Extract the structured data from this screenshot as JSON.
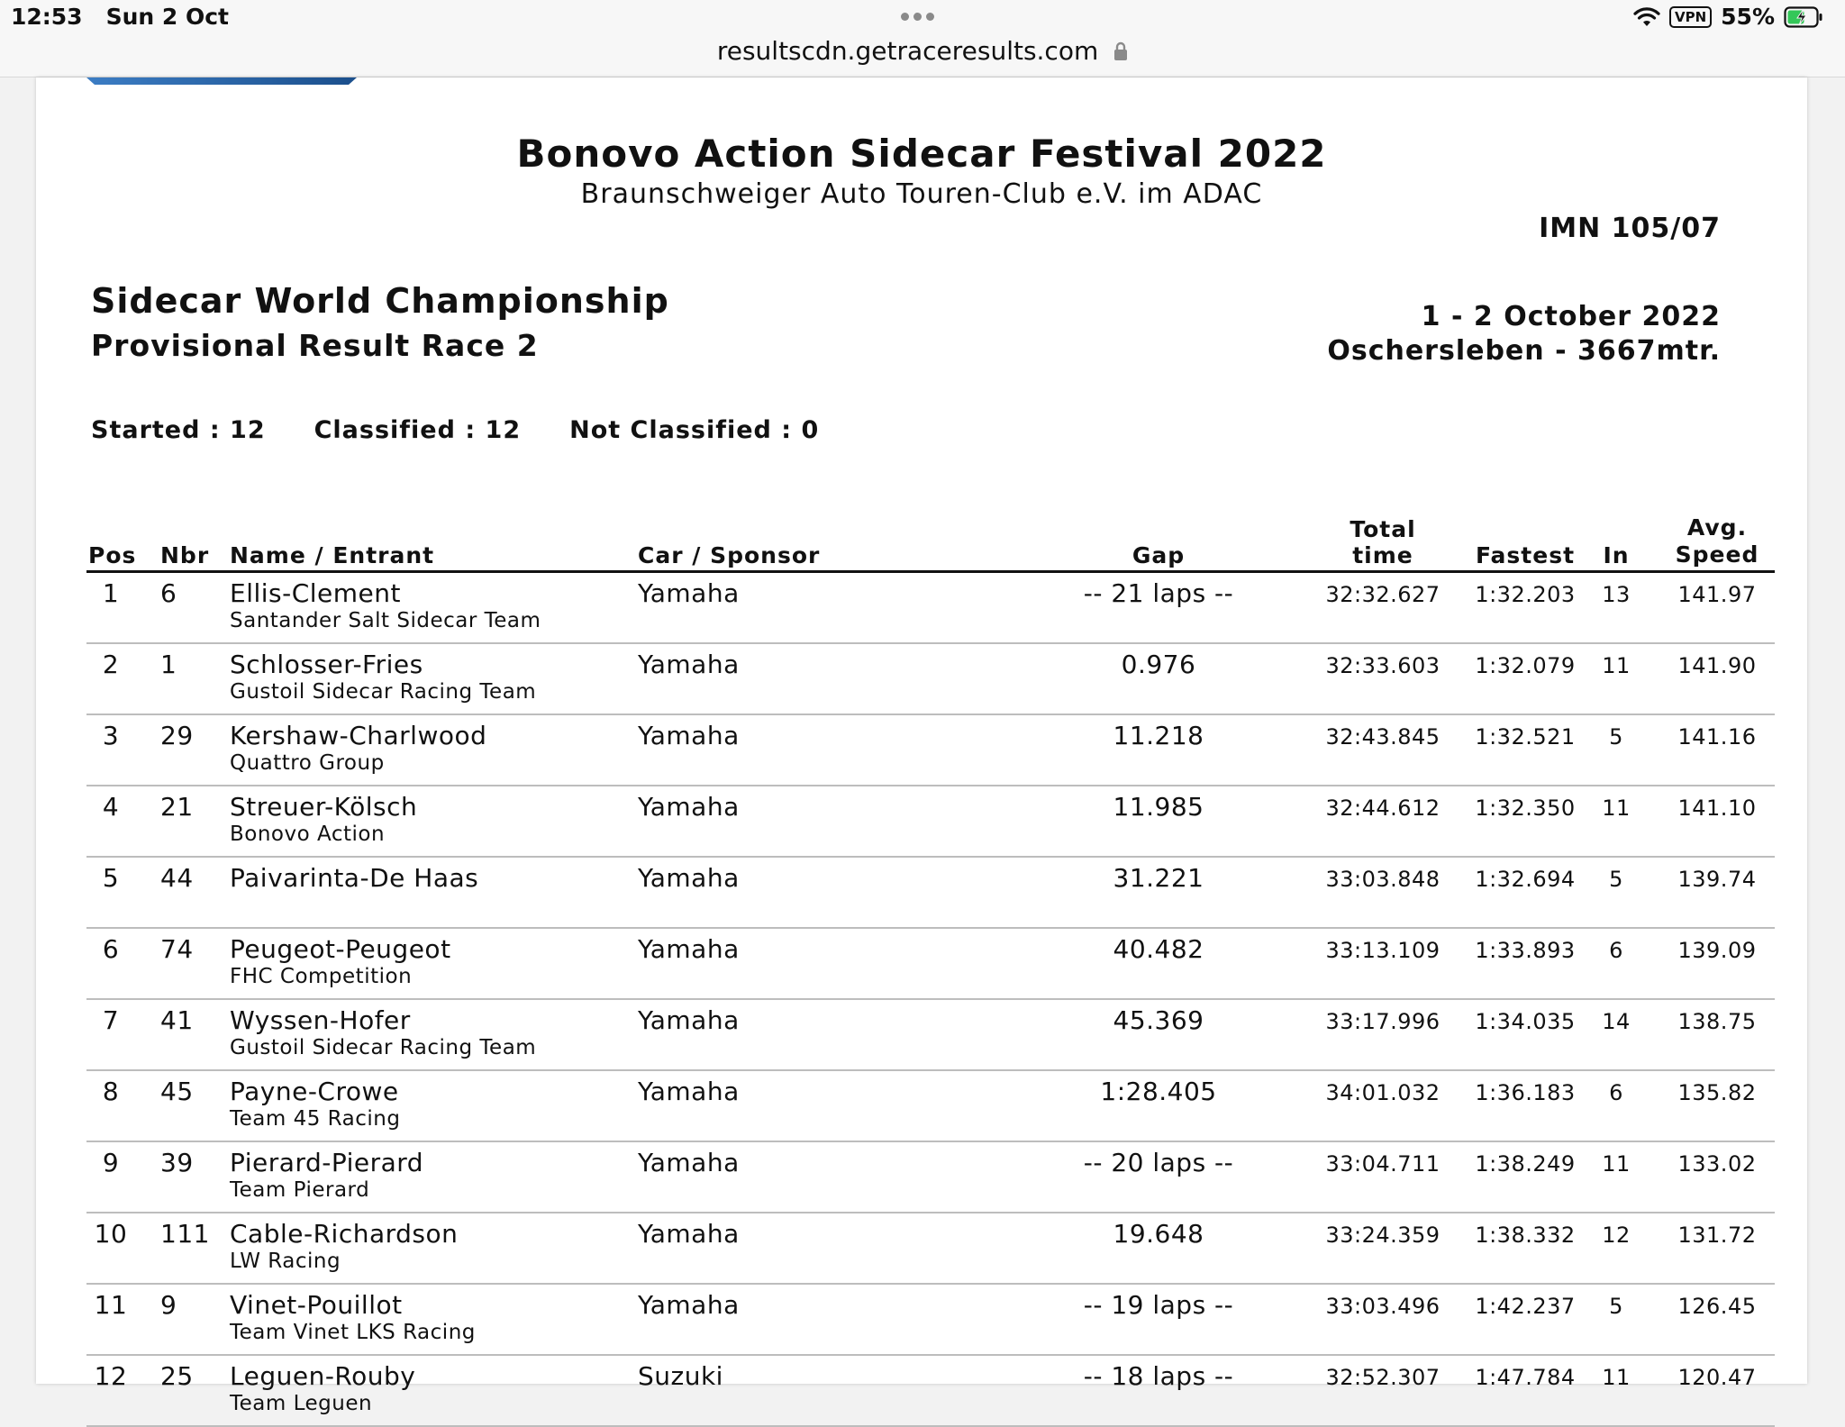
{
  "status_bar": {
    "time": "12:53",
    "date": "Sun 2 Oct",
    "vpn": "VPN",
    "battery": "55%"
  },
  "browser": {
    "url": "resultscdn.getraceresults.com"
  },
  "document": {
    "title": "Bonovo Action Sidecar Festival 2022",
    "subtitle": "Braunschweiger Auto Touren-Club e.V. im ADAC",
    "code": "IMN 105/07",
    "championship": "Sidecar World Championship",
    "race": "Provisional Result Race 2",
    "date": "1 - 2 October 2022",
    "venue": "Oschersleben - 3667mtr.",
    "summary": {
      "started": "Started : 12",
      "classified": "Classified : 12",
      "not_classified": "Not Classified : 0"
    }
  },
  "table": {
    "headers": {
      "pos": "Pos",
      "nbr": "Nbr",
      "name": "Name / Entrant",
      "car": "Car / Sponsor",
      "gap": "Gap",
      "total": "Total time",
      "fastest": "Fastest",
      "in": "In",
      "speed_line1": "Avg.",
      "speed_line2": "Speed"
    },
    "rows": [
      {
        "pos": "1",
        "nbr": "6",
        "name": "Ellis-Clement",
        "entrant": "Santander Salt Sidecar Team",
        "car": "Yamaha",
        "gap": "-- 21 laps --",
        "total": "32:32.627",
        "fastest": "1:32.203",
        "in": "13",
        "speed": "141.97"
      },
      {
        "pos": "2",
        "nbr": "1",
        "name": "Schlosser-Fries",
        "entrant": "Gustoil Sidecar Racing Team",
        "car": "Yamaha",
        "gap": "0.976",
        "total": "32:33.603",
        "fastest": "1:32.079",
        "in": "11",
        "speed": "141.90"
      },
      {
        "pos": "3",
        "nbr": "29",
        "name": "Kershaw-Charlwood",
        "entrant": "Quattro Group",
        "car": "Yamaha",
        "gap": "11.218",
        "total": "32:43.845",
        "fastest": "1:32.521",
        "in": "5",
        "speed": "141.16"
      },
      {
        "pos": "4",
        "nbr": "21",
        "name": "Streuer-Kölsch",
        "entrant": "Bonovo Action",
        "car": "Yamaha",
        "gap": "11.985",
        "total": "32:44.612",
        "fastest": "1:32.350",
        "in": "11",
        "speed": "141.10"
      },
      {
        "pos": "5",
        "nbr": "44",
        "name": "Paivarinta-De Haas",
        "entrant": "",
        "car": "Yamaha",
        "gap": "31.221",
        "total": "33:03.848",
        "fastest": "1:32.694",
        "in": "5",
        "speed": "139.74"
      },
      {
        "pos": "6",
        "nbr": "74",
        "name": "Peugeot-Peugeot",
        "entrant": "FHC Competition",
        "car": "Yamaha",
        "gap": "40.482",
        "total": "33:13.109",
        "fastest": "1:33.893",
        "in": "6",
        "speed": "139.09"
      },
      {
        "pos": "7",
        "nbr": "41",
        "name": "Wyssen-Hofer",
        "entrant": "Gustoil Sidecar Racing Team",
        "car": "Yamaha",
        "gap": "45.369",
        "total": "33:17.996",
        "fastest": "1:34.035",
        "in": "14",
        "speed": "138.75"
      },
      {
        "pos": "8",
        "nbr": "45",
        "name": "Payne-Crowe",
        "entrant": "Team 45 Racing",
        "car": "Yamaha",
        "gap": "1:28.405",
        "total": "34:01.032",
        "fastest": "1:36.183",
        "in": "6",
        "speed": "135.82"
      },
      {
        "pos": "9",
        "nbr": "39",
        "name": "Pierard-Pierard",
        "entrant": "Team Pierard",
        "car": "Yamaha",
        "gap": "-- 20 laps --",
        "total": "33:04.711",
        "fastest": "1:38.249",
        "in": "11",
        "speed": "133.02"
      },
      {
        "pos": "10",
        "nbr": "111",
        "name": "Cable-Richardson",
        "entrant": "LW Racing",
        "car": "Yamaha",
        "gap": "19.648",
        "total": "33:24.359",
        "fastest": "1:38.332",
        "in": "12",
        "speed": "131.72"
      },
      {
        "pos": "11",
        "nbr": "9",
        "name": "Vinet-Pouillot",
        "entrant": "Team Vinet LKS Racing",
        "car": "Yamaha",
        "gap": "-- 19 laps --",
        "total": "33:03.496",
        "fastest": "1:42.237",
        "in": "5",
        "speed": "126.45"
      },
      {
        "pos": "12",
        "nbr": "25",
        "name": "Leguen-Rouby",
        "entrant": "Team Leguen",
        "car": "Suzuki",
        "gap": "-- 18 laps --",
        "total": "32:52.307",
        "fastest": "1:47.784",
        "in": "11",
        "speed": "120.47"
      }
    ]
  }
}
